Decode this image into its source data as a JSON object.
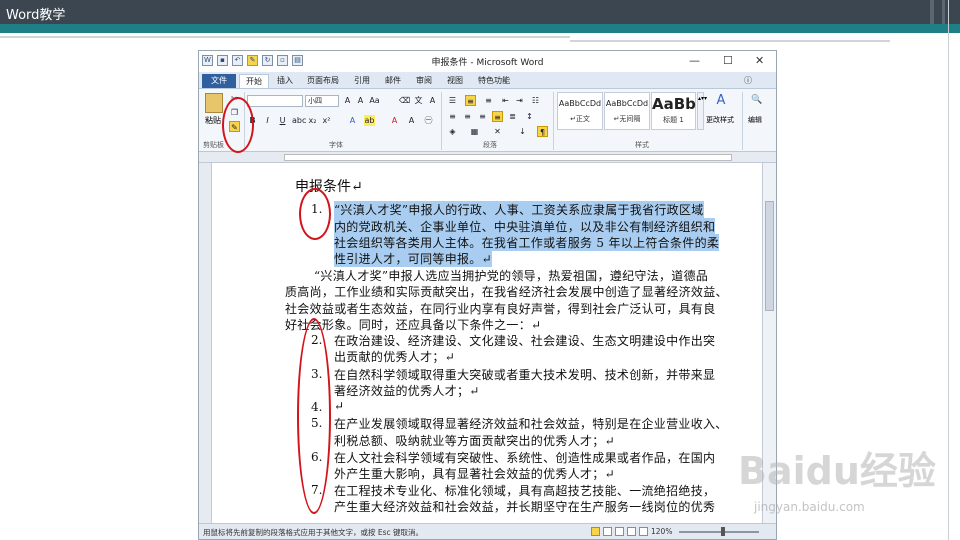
{
  "slide": {
    "title": "Word教学"
  },
  "window": {
    "title": "申报条件 - Microsoft Word",
    "controls": {
      "minimize": "—",
      "maximize": "☐",
      "close": "✕"
    }
  },
  "tabs": [
    "文件",
    "开始",
    "插入",
    "页面布局",
    "引用",
    "邮件",
    "审阅",
    "视图",
    "特色功能"
  ],
  "ribbon": {
    "paste_label": "粘贴",
    "font_name": "",
    "font_size": "小四",
    "styles": [
      {
        "sample": "AaBbCcDd",
        "label": "↵正文"
      },
      {
        "sample": "AaBbCcDd",
        "label": "↵无间隔"
      },
      {
        "sample": "AaBb",
        "label": "标题 1"
      }
    ],
    "change_styles_label": "更改样式",
    "edit_label": "编辑",
    "groups": {
      "clipboard": "剪贴板",
      "font": "字体",
      "paragraph": "段落",
      "styles": "样式"
    }
  },
  "document": {
    "title": "申报条件↵",
    "item1_num": "1.",
    "item1_lines": [
      "“兴滇人才奖”申报人的行政、人事、工资关系应隶属于我省行政区域",
      "内的党政机关、企事业单位、中央驻滇单位，以及非公有制经济组织和",
      "社会组织等各类用人主体。在我省工作或者服务 5 年以上符合条件的柔",
      "性引进人才，可同等申报。↵"
    ],
    "para_lines": [
      "“兴滇人才奖”申报人选应当拥护党的领导，热爱祖国，遵纪守法，道德品",
      "质高尚，工作业绩和实际贡献突出，在我省经济社会发展中创造了显著经济效益、",
      "社会效益或者生态效益，在同行业内享有良好声誉，得到社会广泛认可，具有良",
      "好社会形象。同时，还应具备以下条件之一：↵"
    ],
    "items": [
      {
        "num": "2.",
        "lines": [
          "在政治建设、经济建设、文化建设、社会建设、生态文明建设中作出突",
          "出贡献的优秀人才；↵"
        ]
      },
      {
        "num": "3.",
        "lines": [
          "在自然科学领域取得重大突破或者重大技术发明、技术创新，并带来显",
          "著经济效益的优秀人才；↵"
        ]
      },
      {
        "num": "4.",
        "lines": [
          "↵"
        ]
      },
      {
        "num": "5.",
        "lines": [
          "在产业发展领域取得显著经济效益和社会效益，特别是在企业营业收入、",
          "利税总额、吸纳就业等方面贡献突出的优秀人才；↵"
        ]
      },
      {
        "num": "6.",
        "lines": [
          "在人文社会科学领域有突破性、系统性、创造性成果或者作品，在国内",
          "外产生重大影响，具有显著社会效益的优秀人才；↵"
        ]
      },
      {
        "num": "7.",
        "lines": [
          "在工程技术专业化、标准化领域，具有高超技艺技能、一流绝招绝技，",
          "产生重大经济效益和社会效益，并长期坚守在生产服务一线岗位的优秀"
        ]
      }
    ]
  },
  "status": {
    "message": "用鼠标将先前复制的段落格式应用于其他文字，或按 Esc 键取消。",
    "zoom": "120%"
  },
  "watermark": {
    "brand": "Baidu经验",
    "url": "jingyan.baidu.com"
  },
  "colors": {
    "header": "#3c4650",
    "accent": "#1f7f86",
    "selection": "#a9cdf0",
    "annotation": "#d3141a"
  }
}
